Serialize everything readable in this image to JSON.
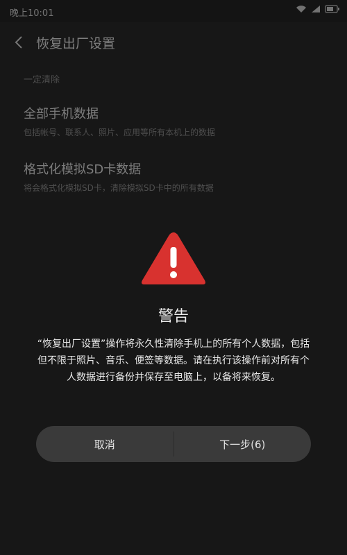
{
  "status_bar": {
    "time": "晚上10:01",
    "icons": [
      "wifi-icon",
      "signal-icon",
      "battery-icon"
    ]
  },
  "header": {
    "title": "恢复出厂设置",
    "back_icon": "back-arrow-icon"
  },
  "background_list": {
    "section_label": "一定清除",
    "items": [
      {
        "title": "全部手机数据",
        "subtitle": "包括帐号、联系人、照片、应用等所有本机上的数据"
      },
      {
        "title": "格式化模拟SD卡数据",
        "subtitle": "将会格式化模拟SD卡，清除模拟SD卡中的所有数据"
      }
    ]
  },
  "dialog": {
    "icon": "warning-triangle-icon",
    "title": "警告",
    "message": "“恢复出厂设置”操作将永久性清除手机上的所有个人数据，包括但不限于照片、音乐、便签等数据。请在执行该操作前对所有个人数据进行备份并保存至电脑上，以备将来恢复。",
    "cancel_label": "取消",
    "next_label": "下一步(6)"
  },
  "colors": {
    "background": "#2a2a2a",
    "warning_red": "#d8322f",
    "button_bg": "#3a3a3a"
  }
}
